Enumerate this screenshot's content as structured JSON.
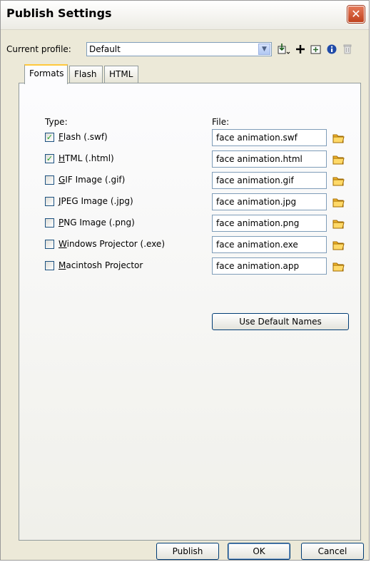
{
  "window": {
    "title": "Publish Settings",
    "close_glyph": "✕"
  },
  "profile": {
    "label": "Current profile:",
    "value": "Default"
  },
  "toolbar": {
    "icons": [
      "import-export-icon",
      "add-profile-icon",
      "duplicate-profile-icon",
      "info-icon",
      "delete-profile-icon"
    ]
  },
  "tabs": [
    {
      "label": "Formats",
      "active": true
    },
    {
      "label": "Flash",
      "active": false
    },
    {
      "label": "HTML",
      "active": false
    }
  ],
  "formats": {
    "type_heading": "Type:",
    "file_heading": "File:",
    "rows": [
      {
        "accel": "F",
        "rest": "lash  (.swf)",
        "checked": true,
        "file": "face animation.swf"
      },
      {
        "accel": "H",
        "rest": "TML (.html)",
        "checked": true,
        "file": "face animation.html"
      },
      {
        "accel": "G",
        "rest": "IF Image (.gif)",
        "checked": false,
        "file": "face animation.gif"
      },
      {
        "accel": "J",
        "rest": "PEG Image (.jpg)",
        "checked": false,
        "file": "face animation.jpg"
      },
      {
        "accel": "P",
        "rest": "NG Image (.png)",
        "checked": false,
        "file": "face animation.png"
      },
      {
        "accel": "W",
        "rest": "indows Projector (.exe)",
        "checked": false,
        "file": "face animation.exe"
      },
      {
        "accel": "M",
        "rest": "acintosh Projector",
        "checked": false,
        "file": "face animation.app"
      }
    ],
    "use_default_names": "Use Default Names"
  },
  "buttons": {
    "publish": "Publish",
    "ok": "OK",
    "cancel": "Cancel"
  },
  "colors": {
    "accent": "#ffc83c",
    "check": "#21a121",
    "close": "#c0411c"
  }
}
